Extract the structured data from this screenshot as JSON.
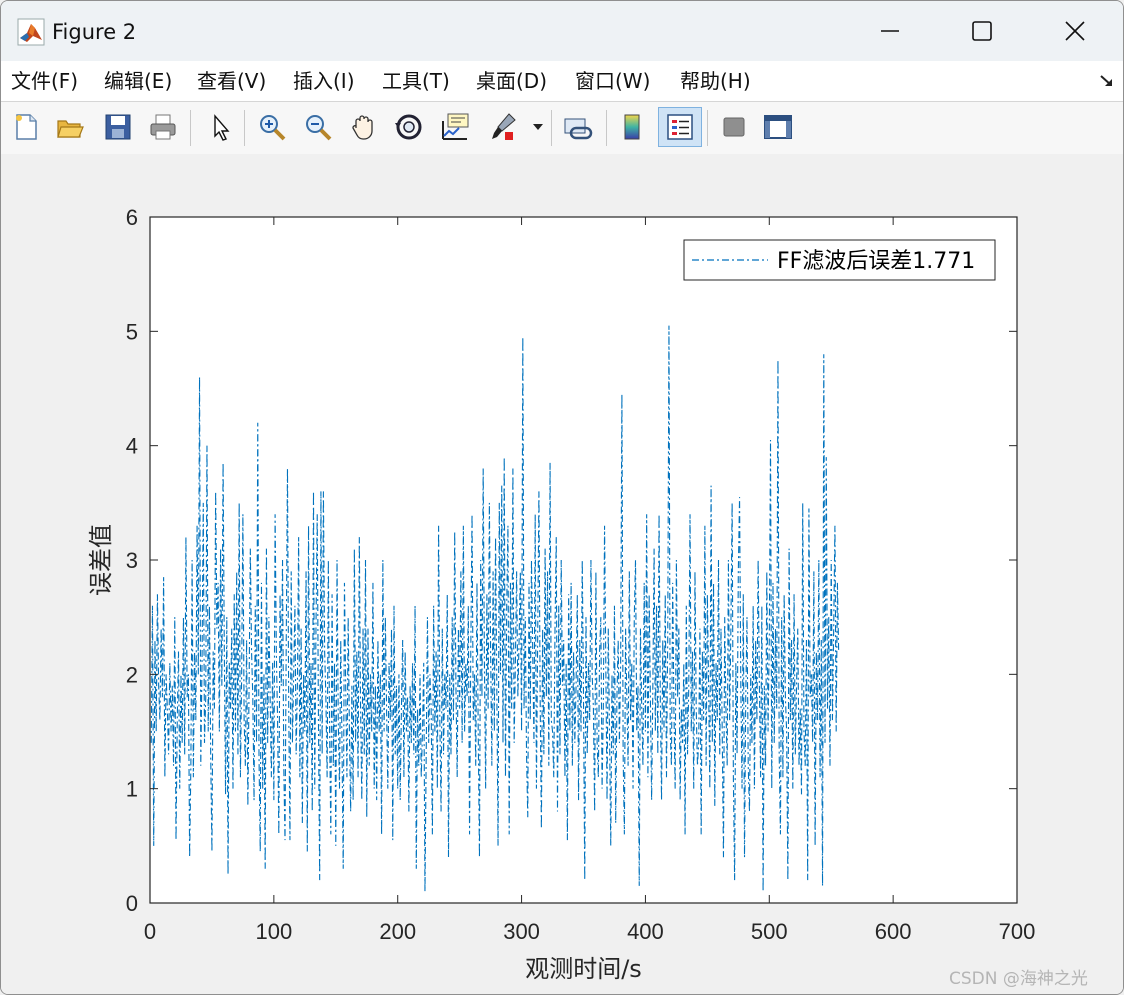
{
  "window": {
    "title": "Figure 2",
    "icon": "matlab-icon"
  },
  "menu": [
    "文件(F)",
    "编辑(E)",
    "查看(V)",
    "插入(I)",
    "工具(T)",
    "桌面(D)",
    "窗口(W)",
    "帮助(H)"
  ],
  "toolbar": {
    "icons": [
      "new-figure-icon",
      "open-icon",
      "save-icon",
      "print-icon",
      "edit-plot-icon",
      "zoom-in-icon",
      "zoom-out-icon",
      "pan-icon",
      "rotate-3d-icon",
      "data-cursor-icon",
      "brush-icon",
      "brush-dropdown-icon",
      "link-plot-icon",
      "colorbar-icon",
      "legend-icon",
      "hide-plot-tools-icon",
      "show-plot-tools-icon"
    ],
    "active": "legend-icon"
  },
  "colors": {
    "series": "#0072bd",
    "axes": "#262626",
    "figure_bg": "#f0f0f0",
    "axes_bg": "#ffffff"
  },
  "chart_data": {
    "type": "line",
    "line_style": "dash-dot",
    "title": "",
    "xlabel": "观测时间/s",
    "ylabel": "误差值",
    "xlim": [
      0,
      700
    ],
    "ylim": [
      0,
      6
    ],
    "xticks": [
      "0",
      "100",
      "200",
      "300",
      "400",
      "500",
      "600",
      "700"
    ],
    "yticks": [
      "0",
      "1",
      "2",
      "3",
      "4",
      "5",
      "6"
    ],
    "grid": false,
    "legend_position": "top-right",
    "series": [
      {
        "name": "FF滤波后误差1.771",
        "x_start": 1,
        "x_step": 1,
        "values": [
          1.4,
          2.6,
          0.5,
          2.3,
          1.5,
          2.7,
          1.9,
          1.6,
          2.4,
          1.8,
          2.85,
          1.1,
          2.0,
          1.7,
          1.3,
          2.1,
          1.5,
          1.9,
          1.2,
          2.5,
          0.55,
          1.6,
          2.2,
          1.0,
          2.0,
          1.4,
          2.5,
          1.3,
          3.2,
          1.8,
          2.0,
          0.4,
          1.2,
          3.0,
          1.1,
          2.2,
          1.6,
          3.3,
          2.0,
          4.6,
          1.2,
          2.1,
          3.5,
          1.4,
          1.8,
          4.0,
          1.5,
          2.6,
          1.3,
          0.45,
          2.2,
          1.7,
          3.6,
          2.4,
          2.8,
          1.5,
          3.1,
          1.9,
          3.85,
          2.2,
          0.95,
          2.5,
          0.25,
          2.1,
          1.7,
          2.4,
          1.0,
          2.7,
          1.5,
          2.9,
          1.3,
          3.5,
          1.1,
          2.0,
          3.4,
          1.6,
          1.2,
          2.3,
          0.85,
          1.9,
          3.1,
          2.2,
          1.8,
          0.9,
          2.6,
          1.4,
          4.2,
          1.3,
          0.45,
          2.8,
          1.0,
          2.0,
          0.3,
          3.1,
          1.4,
          2.5,
          1.8,
          1.1,
          2.1,
          0.9,
          3.4,
          2.2,
          1.6,
          0.6,
          2.7,
          1.9,
          3.0,
          1.2,
          0.55,
          2.3,
          3.8,
          1.7,
          0.55,
          2.9,
          1.4,
          2.0,
          2.6,
          1.3,
          1.9,
          3.2,
          1.1,
          2.4,
          0.7,
          2.0,
          1.5,
          2.9,
          0.45,
          3.3,
          1.4,
          2.1,
          0.8,
          3.6,
          1.0,
          2.4,
          3.4,
          1.6,
          0.2,
          3.6,
          1.3,
          3.6,
          2.2,
          1.8,
          1.1,
          3.0,
          1.5,
          0.6,
          2.7,
          1.2,
          2.1,
          0.5,
          3.0,
          1.6,
          1.0,
          2.3,
          1.4,
          0.3,
          2.8,
          1.9,
          1.1,
          2.5,
          1.5,
          0.8,
          1.9,
          0.9,
          3.1,
          1.4,
          2.2,
          1.1,
          3.2,
          1.7,
          0.9,
          2.4,
          1.3,
          3.0,
          0.75,
          2.4,
          1.2,
          2.0,
          1.5,
          2.8,
          1.0,
          1.9,
          0.9,
          2.3,
          1.5,
          2.0,
          0.6,
          3.0,
          1.5,
          2.5,
          1.7,
          1.0,
          2.1,
          1.6,
          2.4,
          0.55,
          2.6,
          1.3,
          1.9,
          1.0,
          2.0,
          0.9,
          1.7,
          2.3,
          1.1,
          2.2,
          1.5,
          1.8,
          0.8,
          1.9,
          1.4,
          2.1,
          1.3,
          2.6,
          0.3,
          1.7,
          1.2,
          2.0,
          1.1,
          1.5,
          2.1,
          0.1,
          1.3,
          2.5,
          1.4,
          2.0,
          1.7,
          0.6,
          2.6,
          1.5,
          2.2,
          1.0,
          3.3,
          1.6,
          0.8,
          2.4,
          1.3,
          2.0,
          1.7,
          2.7,
          0.4,
          2.0,
          1.3,
          2.5,
          1.6,
          3.25,
          1.9,
          1.1,
          2.4,
          1.7,
          2.9,
          1.4,
          3.3,
          1.5,
          2.1,
          1.8,
          2.6,
          0.6,
          2.2,
          3.4,
          1.6,
          2.0,
          1.2,
          2.8,
          1.5,
          0.4,
          3.0,
          1.8,
          3.8,
          2.1,
          1.0,
          2.7,
          1.7,
          3.5,
          2.2,
          1.2,
          2.9,
          1.5,
          3.2,
          1.9,
          0.5,
          3.5,
          2.0,
          3.65,
          1.4,
          3.9,
          1.1,
          2.6,
          3.3,
          0.6,
          2.8,
          1.7,
          3.8,
          1.4,
          2.1,
          2.9,
          1.8,
          2.3,
          2.9,
          1.5,
          4.95,
          1.7,
          2.5,
          1.3,
          0.75,
          2.8,
          1.6,
          3.0,
          2.2,
          1.4,
          3.4,
          1.0,
          2.3,
          3.6,
          1.8,
          0.65,
          2.4,
          1.3,
          3.1,
          1.8,
          2.9,
          1.2,
          3.85,
          1.6,
          1.5,
          1.1,
          2.4,
          3.2,
          0.8,
          2.6,
          1.3,
          3.0,
          1.9,
          2.3,
          1.1,
          2.1,
          0.55,
          2.7,
          1.5,
          2.8,
          1.2,
          2.2,
          1.4,
          1.9,
          2.7,
          0.9,
          2.3,
          1.5,
          3.0,
          1.8,
          0.2,
          2.5,
          1.3,
          2.1,
          1.6,
          3.0,
          2.0,
          1.7,
          0.8,
          2.9,
          1.4,
          1.1,
          2.2,
          2.5,
          1.0,
          1.7,
          3.3,
          2.1,
          0.9,
          2.4,
          1.5,
          0.5,
          2.0,
          1.3,
          2.6,
          0.7,
          1.8,
          2.3,
          1.4,
          2.1,
          4.45,
          1.3,
          0.6,
          2.4,
          1.8,
          1.2,
          2.9,
          1.6,
          2.1,
          1.0,
          2.5,
          3.0,
          1.5,
          1.9,
          0.15,
          2.4,
          1.7,
          1.2,
          2.8,
          1.5,
          3.4,
          1.1,
          2.7,
          1.8,
          0.9,
          1.9,
          3.1,
          1.5,
          2.6,
          1.3,
          3.4,
          1.8,
          0.9,
          2.3,
          1.5,
          2.7,
          1.1,
          2.3,
          5.05,
          1.5,
          1.2,
          2.8,
          1.7,
          1.0,
          3.0,
          1.8,
          2.4,
          0.9,
          1.7,
          1.4,
          2.1,
          0.6,
          2.6,
          1.3,
          1.9,
          3.4,
          1.5,
          2.2,
          1.0,
          2.9,
          1.7,
          1.2,
          1.4,
          2.4,
          0.6,
          2.2,
          1.6,
          3.3,
          1.2,
          2.7,
          1.9,
          1.0,
          3.65,
          1.4,
          2.8,
          0.85,
          2.1,
          1.6,
          3.0,
          1.3,
          2.4,
          1.5,
          0.4,
          2.5,
          1.7,
          1.2,
          3.0,
          1.6,
          2.4,
          3.5,
          1.1,
          0.2,
          2.1,
          1.3,
          2.9,
          3.55,
          1.9,
          1.0,
          2.7,
          0.4,
          1.8,
          2.5,
          1.2,
          0.8,
          2.0,
          1.4,
          2.6,
          1.0,
          2.3,
          1.6,
          3.0,
          1.9,
          1.1,
          2.6,
          0.1,
          1.9,
          1.2,
          2.9,
          1.5,
          2.3,
          4.05,
          1.0,
          2.8,
          1.4,
          2.4,
          1.7,
          4.75,
          1.3,
          0.6,
          2.5,
          1.1,
          2.7,
          1.8,
          1.5,
          0.2,
          3.1,
          1.6,
          2.3,
          1.0,
          2.7,
          1.3,
          1.9,
          2.4,
          1.2,
          1.7,
          0.95,
          3.5,
          1.5,
          1.2,
          2.3,
          0.2,
          3.45,
          1.8,
          2.0,
          1.4,
          2.9,
          0.5,
          2.2,
          1.6,
          3.0,
          1.1,
          2.3,
          0.15,
          4.8,
          1.4,
          3.9,
          1.7,
          2.5,
          1.2,
          3.0,
          1.6,
          2.4,
          3.3,
          1.5,
          2.8,
          2.2
        ]
      }
    ]
  },
  "watermark": "CSDN @海神之光"
}
